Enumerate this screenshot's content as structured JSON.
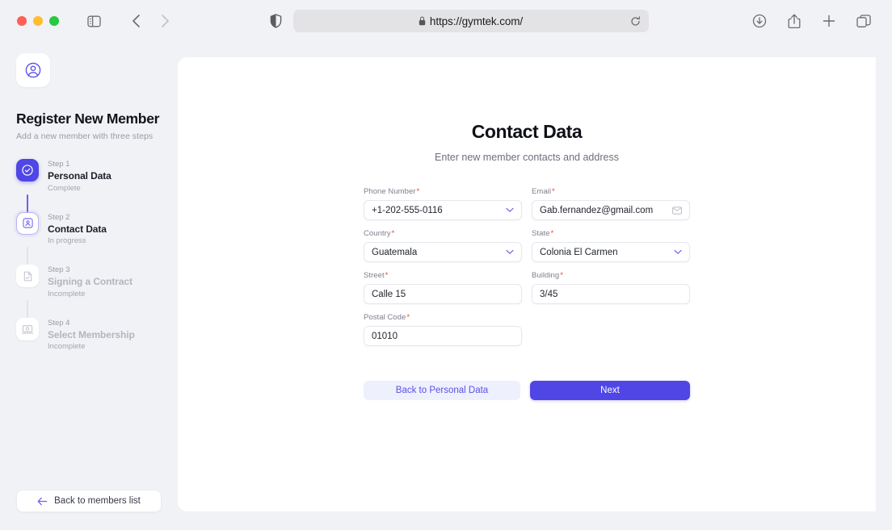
{
  "browser": {
    "url": "https://gymtek.com/",
    "lock_icon": "lock-icon",
    "shield_icon": "shield-icon",
    "reload_icon": "reload-icon",
    "sidebar_icon": "sidebar-toggle-icon",
    "back_icon": "back-chevron-icon",
    "forward_icon": "forward-chevron-icon",
    "downloads_icon": "downloads-icon",
    "share_icon": "share-icon",
    "new_tab_icon": "plus-icon",
    "tab_overview_icon": "tab-overview-icon"
  },
  "sidebar": {
    "avatar_icon": "user-circle-icon",
    "title": "Register New Member",
    "subtitle": "Add a new member with three steps",
    "steps": [
      {
        "num": "Step 1",
        "name": "Personal Data",
        "state": "Complete",
        "icon": "check-circle-icon",
        "status": "done"
      },
      {
        "num": "Step 2",
        "name": "Contact Data",
        "state": "In progress",
        "icon": "id-card-icon",
        "status": "current"
      },
      {
        "num": "Step 3",
        "name": "Signing a Contract",
        "state": "Incomplete",
        "icon": "document-check-icon",
        "status": "incomplete"
      },
      {
        "num": "Step 4",
        "name": "Select Membership",
        "state": "Incomplete",
        "icon": "membership-card-icon",
        "status": "incomplete"
      }
    ],
    "back_button": {
      "label": "Back to members list",
      "icon": "arrow-left-icon"
    }
  },
  "form": {
    "title": "Contact Data",
    "subtitle": "Enter new member contacts and address",
    "fields": [
      {
        "label": "Phone Number",
        "required": "*",
        "value": "+1-202-555-0116",
        "control": "dropdown"
      },
      {
        "label": "Email",
        "required": "*",
        "value": "Gab.fernandez@gmail.com",
        "control": "mail"
      },
      {
        "label": "Country",
        "required": "*",
        "value": "Guatemala",
        "control": "dropdown"
      },
      {
        "label": "State",
        "required": "*",
        "value": "Colonia El Carmen",
        "control": "dropdown"
      },
      {
        "label": "Street",
        "required": "*",
        "value": "Calle 15",
        "control": "text"
      },
      {
        "label": "Building",
        "required": "*",
        "value": "3/45",
        "control": "text"
      },
      {
        "label": "Postal Code",
        "required": "*",
        "value": "01010",
        "control": "text"
      }
    ],
    "back_label": "Back to Personal Data",
    "next_label": "Next"
  },
  "colors": {
    "accent": "#4f46e5",
    "accent_soft": "#eef0fd",
    "required": "#f04438",
    "page_bg": "#f1f2f5"
  }
}
